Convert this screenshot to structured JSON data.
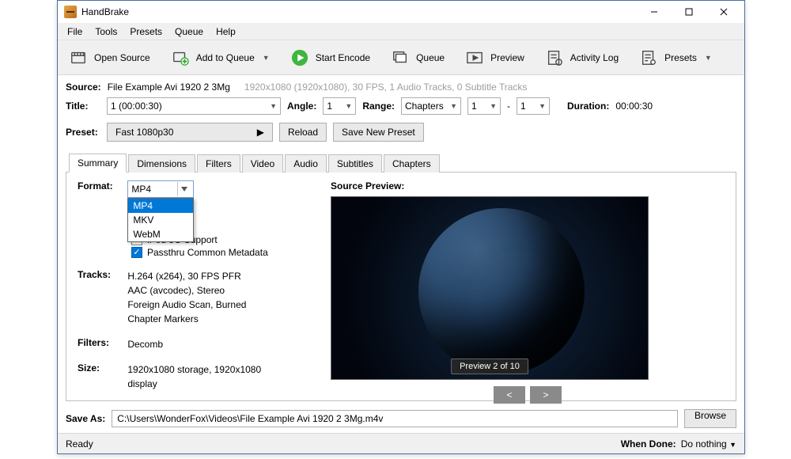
{
  "window": {
    "title": "HandBrake"
  },
  "win_controls": {
    "min": "–",
    "max": "□",
    "close": "✕"
  },
  "menubar": [
    "File",
    "Tools",
    "Presets",
    "Queue",
    "Help"
  ],
  "toolbar": {
    "open_source": "Open Source",
    "add_to_queue": "Add to Queue",
    "start_encode": "Start Encode",
    "queue": "Queue",
    "preview": "Preview",
    "activity_log": "Activity Log",
    "presets": "Presets"
  },
  "source": {
    "label": "Source:",
    "name": "File Example Avi 1920 2 3Mg",
    "info": "1920x1080 (1920x1080), 30 FPS, 1 Audio Tracks, 0 Subtitle Tracks"
  },
  "title_row": {
    "title_label": "Title:",
    "title_value": "1  (00:00:30)",
    "angle_label": "Angle:",
    "angle_value": "1",
    "range_label": "Range:",
    "range_type": "Chapters",
    "range_from": "1",
    "range_dash": "-",
    "range_to": "1",
    "duration_label": "Duration:",
    "duration_value": "00:00:30"
  },
  "preset_row": {
    "preset_label": "Preset:",
    "preset_value": "Fast 1080p30",
    "reload": "Reload",
    "save_new": "Save New Preset"
  },
  "tabs": [
    "Summary",
    "Dimensions",
    "Filters",
    "Video",
    "Audio",
    "Subtitles",
    "Chapters"
  ],
  "summary": {
    "format_label": "Format:",
    "format_value": "MP4",
    "format_options": [
      "MP4",
      "MKV",
      "WebM"
    ],
    "checks": {
      "ipod": "iPod 5G Support",
      "passthru": "Passthru Common Metadata"
    },
    "tracks_label": "Tracks:",
    "tracks_lines": [
      "H.264 (x264), 30 FPS PFR",
      "AAC (avcodec), Stereo",
      "Foreign Audio Scan, Burned",
      "Chapter Markers"
    ],
    "filters_label": "Filters:",
    "filters_value": "Decomb",
    "size_label": "Size:",
    "size_value": "1920x1080 storage, 1920x1080 display"
  },
  "preview": {
    "title": "Source Preview:",
    "badge": "Preview 2 of 10",
    "prev": "<",
    "next": ">"
  },
  "save": {
    "label": "Save As:",
    "path": "C:\\Users\\WonderFox\\Videos\\File Example Avi 1920 2 3Mg.m4v",
    "browse": "Browse"
  },
  "status": {
    "ready": "Ready",
    "when_done_label": "When Done:",
    "when_done_value": "Do nothing"
  }
}
